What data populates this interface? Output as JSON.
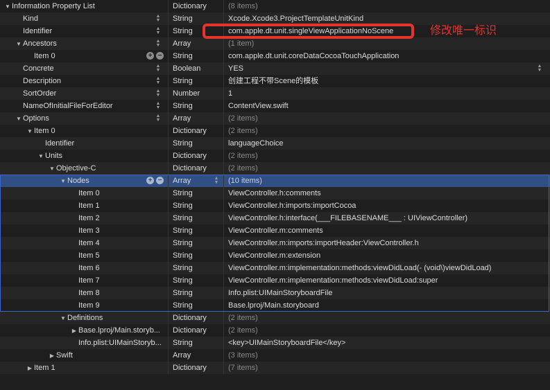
{
  "annotation": {
    "note_text": "修改唯一标识",
    "color": "#e8332b"
  },
  "colors": {
    "selection": "#2f4f85",
    "background": "#1e1e1e",
    "outline": "#3d68c7"
  },
  "rows": [
    {
      "key": "Information Property List",
      "type": "Dictionary",
      "value": "(8 items)",
      "depth": 0,
      "tri": "down",
      "dim": true
    },
    {
      "key": "Kind",
      "type": "String",
      "value": "Xcode.Xcode3.ProjectTemplateUnitKind",
      "depth": 1,
      "tri": "none",
      "sort": true
    },
    {
      "key": "Identifier",
      "type": "String",
      "value": "com.apple.dt.unit.singleViewApplicationNoScene",
      "depth": 1,
      "tri": "none",
      "sort": true
    },
    {
      "key": "Ancestors",
      "type": "Array",
      "value": "(1 item)",
      "depth": 1,
      "tri": "down",
      "dim": true,
      "sort": true
    },
    {
      "key": "Item 0",
      "type": "String",
      "value": "com.apple.dt.unit.coreDataCocoaTouchApplication",
      "depth": 2,
      "tri": "none",
      "pm": true
    },
    {
      "key": "Concrete",
      "type": "Boolean",
      "value": "YES",
      "depth": 1,
      "tri": "none",
      "sort": true,
      "valsort": true
    },
    {
      "key": "Description",
      "type": "String",
      "value": "创建工程不带Scene的模板",
      "depth": 1,
      "tri": "none",
      "sort": true
    },
    {
      "key": "SortOrder",
      "type": "Number",
      "value": "1",
      "depth": 1,
      "tri": "none",
      "sort": true
    },
    {
      "key": "NameOfInitialFileForEditor",
      "type": "String",
      "value": "ContentView.swift",
      "depth": 1,
      "tri": "none",
      "sort": true
    },
    {
      "key": "Options",
      "type": "Array",
      "value": "(2 items)",
      "depth": 1,
      "tri": "down",
      "dim": true,
      "sort": true
    },
    {
      "key": "Item 0",
      "type": "Dictionary",
      "value": "(2 items)",
      "depth": 2,
      "tri": "down",
      "dim": true
    },
    {
      "key": "Identifier",
      "type": "String",
      "value": "languageChoice",
      "depth": 3,
      "tri": "none"
    },
    {
      "key": "Units",
      "type": "Dictionary",
      "value": "(2 items)",
      "depth": 3,
      "tri": "down",
      "dim": true
    },
    {
      "key": "Objective-C",
      "type": "Dictionary",
      "value": "(2 items)",
      "depth": 4,
      "tri": "down",
      "dim": true
    },
    {
      "key": "Nodes",
      "type": "Array",
      "value": "(10 items)",
      "depth": 5,
      "tri": "down",
      "dim": true,
      "selected": true,
      "pm": true,
      "typesort": true
    },
    {
      "key": "Item 0",
      "type": "String",
      "value": "ViewController.h:comments",
      "depth": 6,
      "tri": "none"
    },
    {
      "key": "Item 1",
      "type": "String",
      "value": "ViewController.h:imports:importCocoa",
      "depth": 6,
      "tri": "none"
    },
    {
      "key": "Item 2",
      "type": "String",
      "value": "ViewController.h:interface(___FILEBASENAME___ : UIViewController)",
      "depth": 6,
      "tri": "none"
    },
    {
      "key": "Item 3",
      "type": "String",
      "value": "ViewController.m:comments",
      "depth": 6,
      "tri": "none"
    },
    {
      "key": "Item 4",
      "type": "String",
      "value": "ViewController.m:imports:importHeader:ViewController.h",
      "depth": 6,
      "tri": "none"
    },
    {
      "key": "Item 5",
      "type": "String",
      "value": "ViewController.m:extension",
      "depth": 6,
      "tri": "none"
    },
    {
      "key": "Item 6",
      "type": "String",
      "value": "ViewController.m:implementation:methods:viewDidLoad(- (void\\)viewDidLoad)",
      "depth": 6,
      "tri": "none"
    },
    {
      "key": "Item 7",
      "type": "String",
      "value": "ViewController.m:implementation:methods:viewDidLoad:super",
      "depth": 6,
      "tri": "none"
    },
    {
      "key": "Item 8",
      "type": "String",
      "value": "Info.plist:UIMainStoryboardFile",
      "depth": 6,
      "tri": "none"
    },
    {
      "key": "Item 9",
      "type": "String",
      "value": "Base.lproj/Main.storyboard",
      "depth": 6,
      "tri": "none"
    },
    {
      "key": "Definitions",
      "type": "Dictionary",
      "value": "(2 items)",
      "depth": 5,
      "tri": "down",
      "dim": true
    },
    {
      "key": "Base.lproj/Main.storyb...",
      "type": "Dictionary",
      "value": "(2 items)",
      "depth": 6,
      "tri": "right",
      "dim": true
    },
    {
      "key": "Info.plist:UIMainStoryb...",
      "type": "String",
      "value": "<key>UIMainStoryboardFile</key>",
      "depth": 6,
      "tri": "none"
    },
    {
      "key": "Swift",
      "type": "Array",
      "value": "(3 items)",
      "depth": 4,
      "tri": "right",
      "dim": true
    },
    {
      "key": "Item 1",
      "type": "Dictionary",
      "value": "(7 items)",
      "depth": 2,
      "tri": "right",
      "dim": true
    }
  ]
}
